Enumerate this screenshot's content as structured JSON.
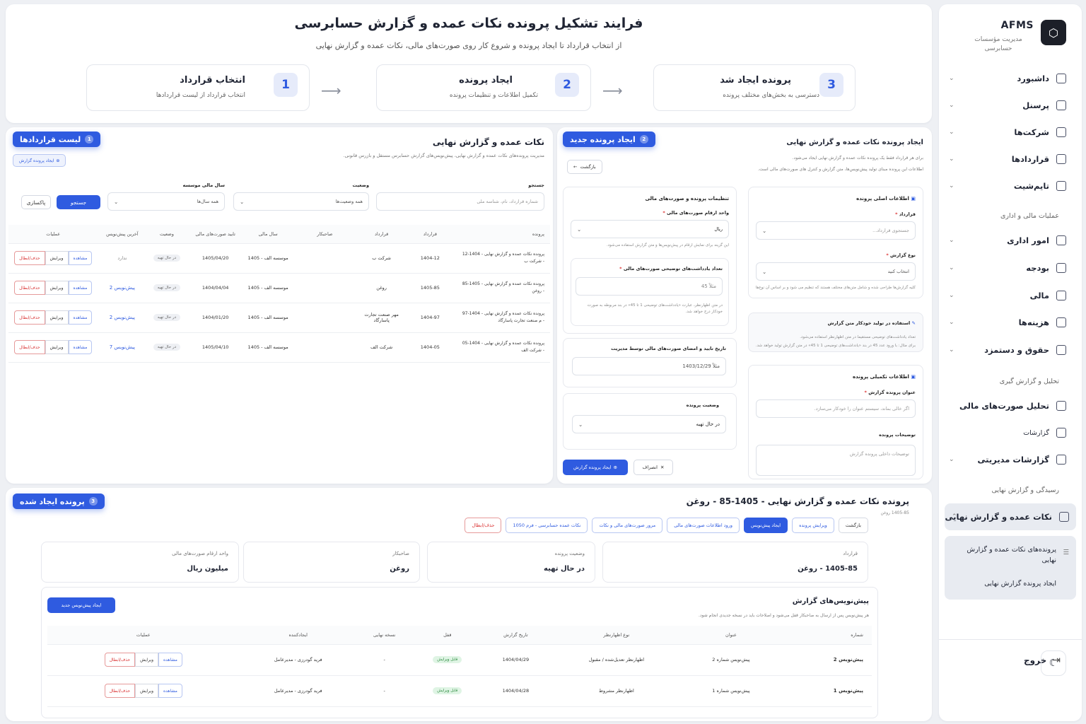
{
  "sidebar": {
    "brand": "AFMS",
    "subtitle": "مدیریت مؤسسات حسابرسی",
    "items": [
      {
        "label": "داشبورد",
        "icon": "dashboard-icon"
      },
      {
        "label": "پرسنل",
        "icon": "users-icon"
      },
      {
        "label": "شرکت‌ها",
        "icon": "building-icon"
      },
      {
        "label": "قراردادها",
        "icon": "contract-icon"
      },
      {
        "label": "تایم‌شیت",
        "icon": "timesheet-icon"
      }
    ],
    "section_admin": "عملیات مالی و اداری",
    "items2": [
      {
        "label": "امور اداری",
        "icon": "admin-icon"
      },
      {
        "label": "بودجه",
        "icon": "budget-icon"
      },
      {
        "label": "مالی",
        "icon": "finance-icon"
      },
      {
        "label": "هزینه‌ها",
        "icon": "expense-icon"
      },
      {
        "label": "حقوق و دستمزد",
        "icon": "payroll-icon"
      }
    ],
    "section_analysis": "تحلیل و گزارش گیری",
    "items3": [
      {
        "label": "تحلیل صورت‌های مالی",
        "icon": "analysis-icon"
      },
      {
        "label": "گزارشات",
        "icon": "reports-icon"
      },
      {
        "label": "گزارشات مدیریتی",
        "icon": "mgmt-reports-icon"
      }
    ],
    "section_review": "رسیدگی و گزارش نهایی",
    "active_item": "نکات عمده و گزارش نهایی",
    "sub_items": [
      "پرونده‌های نکات عمده و گزارش نهایی",
      "ایجاد پرونده گزارش نهایی"
    ],
    "logout": "خروج"
  },
  "header": {
    "title": "فرایند تشکیل پرونده نکات عمده و گزارش حسابرسی",
    "subtitle": "از انتخاب قرارداد تا ایجاد پرونده و شروع کار روی صورت‌های مالی، نکات عمده و گزارش نهایی",
    "steps": [
      {
        "num": "1",
        "title": "انتخاب قرارداد",
        "desc": "انتخاب قرارداد از لیست قراردادها"
      },
      {
        "num": "2",
        "title": "ایجاد پرونده",
        "desc": "تکمیل اطلاعات و تنظیمات پرونده"
      },
      {
        "num": "3",
        "title": "پرونده ایجاد شد",
        "desc": "دسترسی به بخش‌های مختلف پرونده"
      }
    ]
  },
  "contracts": {
    "tag": "لیست قراردادها",
    "tag_num": "1",
    "title": "نکات عمده و گزارش نهایی",
    "desc": "مدیریت پرونده‌های نکات عمده و گزارش نهایی، پیش‌نویس‌های گزارش حسابرس مستقل و بازرس قانونی.",
    "create_btn": "ایجاد پرونده گزارش",
    "search_label": "جستجو",
    "search_placeholder": "شماره قرارداد، نام، شناسه ملی",
    "status_label": "وضعیت",
    "status_value": "همه وضعیت‌ها",
    "year_label": "سال مالی موسسه",
    "year_value": "همه سال‌ها",
    "search_btn": "جستجو",
    "reset_btn": "پاکسازی",
    "columns": [
      "پرونده",
      "قرارداد",
      "قرارداد",
      "صاحبکار",
      "سال مالی",
      "تایید صورت‌های مالی",
      "وضعیت",
      "آخرین پیش‌نویس",
      "عملیات"
    ],
    "rows": [
      {
        "file": "پرونده نکات عمده و گزارش نهایی - 1404-12 - شرکت ب",
        "contract": "1404-12",
        "contract2": "شرکت ب",
        "client": "",
        "year": "موسسه الف - 1405",
        "approve": "1405/04/20",
        "status": "در حال تهیه",
        "draft": "ندارد"
      },
      {
        "file": "پرونده نکات عمده و گزارش نهایی - 1405-85 - روغن",
        "contract": "1405-85",
        "contract2": "روغن",
        "client": "",
        "year": "موسسه الف - 1405",
        "approve": "1404/04/04",
        "status": "در حال تهیه",
        "draft": "پیش‌نویس 2"
      },
      {
        "file": "پرونده نکات عمده و گزارش نهایی - 1404-97 - م صنعت تجارت پاسارگاد",
        "contract": "1404-97",
        "contract2": "مهر صنعت تجارت پاسارگاد",
        "client": "",
        "year": "موسسه الف - 1405",
        "approve": "1404/01/20",
        "status": "در حال تهیه",
        "draft": "پیش‌نویس 2"
      },
      {
        "file": "پرونده نکات عمده و گزارش نهایی - 1404-05 - شرکت الف",
        "contract": "1404-05",
        "contract2": "شرکت الف",
        "client": "",
        "year": "موسسه الف - 1405",
        "approve": "1405/04/10",
        "status": "در حال تهیه",
        "draft": "پیش‌نویس 7"
      }
    ],
    "act_view": "مشاهده",
    "act_edit": "ویرایش",
    "act_delete": "حذف/ابطال"
  },
  "newfile": {
    "tag": "ایجاد پرونده جدید",
    "tag_num": "2",
    "title": "ایجاد پرونده نکات عمده و گزارش نهایی",
    "desc1": "برای هر قرارداد فقط یک پرونده نکات عمده و گزارش نهایی ایجاد می‌شود.",
    "desc2": "اطلاعات این پرونده مبنای تولید پیش‌نویس‌ها، متن گزارش و کنترل های صورت‌های مالی است.",
    "back_btn": "بازگشت",
    "main_info": "اطلاعات اصلی پرونده",
    "contract_label": "قرارداد",
    "contract_placeholder": "جستجوی قرارداد...",
    "report_type_label": "نوع گزارش",
    "report_type_value": "انتخاب کنید",
    "report_hint": "کلیه گزارش‌ها طراحی شده و شامل متن‌های مختلف هستند که تنظیم می شود و بر اساس آن نوع‌ها در زمان ایجاد تحت دسترسی است.",
    "auto_title": "استفاده در تولید خودکار متن گزارش",
    "auto_desc1": "تعداد یادداشت‌های توضیحی مستقیما در متن اظهارنظر استفاده می‌شود.",
    "auto_desc2": "برای مثال: با ورود عدد 45 در بند «یادداشت‌های توضیحی 1 تا 45» در متن گزارش تولید خواهد شد.",
    "extra_info": "اطلاعات تکمیلی پرونده",
    "report_title_label": "عنوان پرونده گزارش",
    "report_title_placeholder": "اگر خالی بماند، سیستم عنوان را خودکار می‌سازد.",
    "file_desc_label": "توضیحات پرونده",
    "file_desc_placeholder": "توضیحات داخلی پرونده گزارش",
    "settings_title": "تنظیمات پرونده و صورت‌های مالی",
    "unit_label": "واحد ارقام صورت‌های مالی",
    "unit_value": "ریال",
    "unit_hint": "این گزینه برای نمایش ارقام در پیش‌نویس‌ها و متن گزارش استفاده می‌شود.",
    "notes_label": "تعداد یادداشت‌های توضیحی صورت‌های مالی",
    "notes_placeholder": "مثلاً 45",
    "notes_hint": "در متن اظهارنظر، عبارت «یادداشت‌های توضیحی 1 تا 45» در بند مربوطه به صورت خودکار درج خواهد شد.",
    "date_label": "تاریخ تایید و امضای صورت‌های مالی توسط مدیریت",
    "date_placeholder": "مثلاً 1403/12/29",
    "status_label": "وضعیت پرونده",
    "status_value": "در حال تهیه",
    "cancel_btn": "انصراف",
    "create_btn": "ایجاد پرونده گزارش"
  },
  "created": {
    "tag": "پرونده ایجاد شده",
    "tag_num": "3",
    "title": "پرونده نکات عمده و گزارش نهایی - 1405-85 - روغن",
    "sub": "1405-85 روغن",
    "buttons": [
      "بازگشت",
      "ویرایش پرونده",
      "ایجاد پیش‌نویس",
      "ورود اطلاعات صورت‌های مالی",
      "مرور صورت‌های مالی و نکات",
      "نکات عمده حسابرسی - فرم 1050"
    ],
    "delete_btn": "حذف/ابطال",
    "info": [
      {
        "k": "قرارداد",
        "v": "1405-85 - روغن"
      },
      {
        "k": "وضعیت پرونده",
        "v": "در حال تهیه"
      },
      {
        "k": "صاحبکار",
        "v": "روغن"
      },
      {
        "k": "واحد ارقام صورت‌های مالی",
        "v": "میلیون ریال"
      }
    ],
    "drafts_title": "پیش‌نویس‌های گزارش",
    "drafts_desc": "هر پیش‌نویس پس از ارسال به صاحبکار قفل می‌شود و اصلاحات باید در نسخه جدیدی انجام شود.",
    "new_draft_btn": "ایجاد پیش‌نویس جدید",
    "columns": [
      "شماره",
      "عنوان",
      "نوع اظهارنظر",
      "تاریخ گزارش",
      "قفل",
      "نسخه نهایی",
      "ایجادکننده",
      "عملیات"
    ],
    "rows": [
      {
        "num": "پیش‌نویس 2",
        "title": "پیش‌نویس شماره 2",
        "type": "اظهارنظر تعدیل‌شده / مقبول",
        "date": "1404/04/29",
        "lock": "قابل ویرایش",
        "final": "-",
        "creator": "فرید گودرزی - مدیرعامل"
      },
      {
        "num": "پیش‌نویس 1",
        "title": "پیش‌نویس شماره 1",
        "type": "اظهارنظر مشروط",
        "date": "1404/04/28",
        "lock": "قابل ویرایش",
        "final": "-",
        "creator": "فرید گودرزی - مدیرعامل"
      }
    ]
  }
}
